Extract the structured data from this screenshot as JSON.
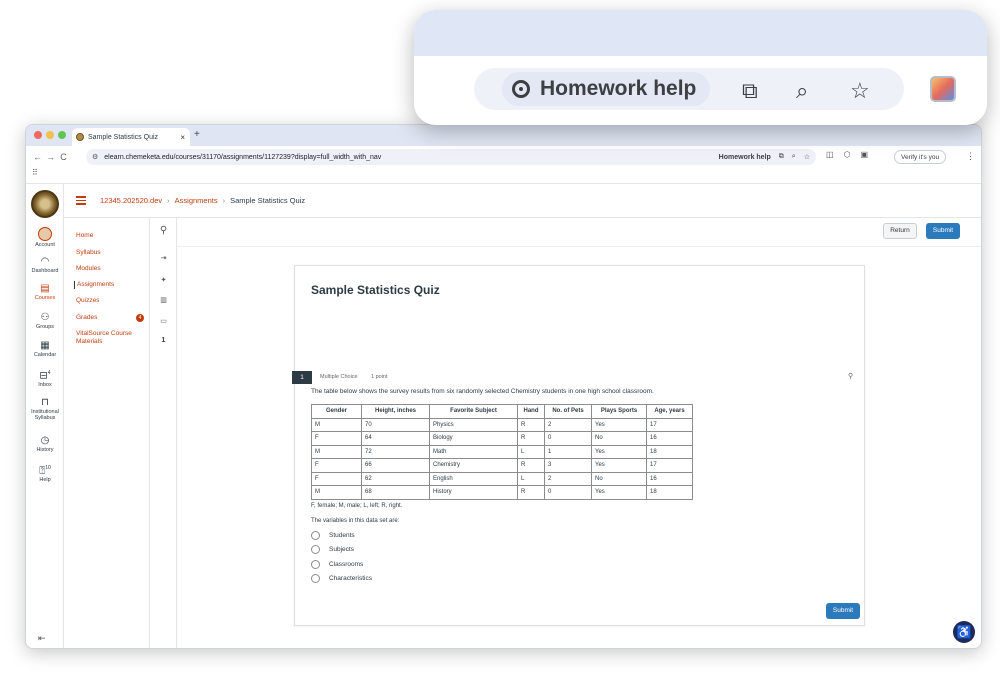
{
  "browser": {
    "tab_title": "Sample Statistics Quiz",
    "tab_close": "×",
    "new_tab": "+",
    "url": "elearn.chemeketa.edu/courses/31170/assignments/1127239?display=full_width_with_nav",
    "homework_help": "Homework help",
    "verify_label": "Verify it's you",
    "bookmarks_icon": "⠿"
  },
  "zoom": {
    "homework_help": "Homework help"
  },
  "breadcrumb": {
    "course": "12345.202520.dev",
    "section": "Assignments",
    "current": "Sample Statistics Quiz",
    "sep": "›"
  },
  "global_nav": {
    "account": "Account",
    "dashboard": "Dashboard",
    "courses": "Courses",
    "groups": "Groups",
    "calendar": "Calendar",
    "inbox": "Inbox",
    "inbox_count": "4",
    "institutional_syllabus": "Institutional Syllabus",
    "history": "History",
    "help": "Help",
    "help_count": "10"
  },
  "course_nav": {
    "home": "Home",
    "syllabus": "Syllabus",
    "modules": "Modules",
    "assignments": "Assignments",
    "quizzes": "Quizzes",
    "grades": "Grades",
    "grades_badge": "4",
    "vitalsource": "VitalSource Course Materials"
  },
  "question_nav": {
    "question_number": "1"
  },
  "actions": {
    "return": "Return",
    "submit": "Submit"
  },
  "quiz": {
    "title": "Sample Statistics Quiz",
    "question_number": "1",
    "question_type": "Multiple Choice",
    "points": "1 point",
    "prompt": "The table below shows the survey results from six randomly selected Chemistry students in one high school classroom.",
    "table": {
      "headers": [
        "Gender",
        "Height, inches",
        "Favorite Subject",
        "Hand",
        "No. of Pets",
        "Plays Sports",
        "Age, years"
      ],
      "rows": [
        [
          "M",
          "70",
          "Physics",
          "R",
          "2",
          "Yes",
          "17"
        ],
        [
          "F",
          "64",
          "Biology",
          "R",
          "0",
          "No",
          "16"
        ],
        [
          "M",
          "72",
          "Math",
          "L",
          "1",
          "Yes",
          "18"
        ],
        [
          "F",
          "66",
          "Chemistry",
          "R",
          "3",
          "Yes",
          "17"
        ],
        [
          "F",
          "62",
          "English",
          "L",
          "2",
          "No",
          "16"
        ],
        [
          "M",
          "68",
          "History",
          "R",
          "0",
          "Yes",
          "18"
        ]
      ]
    },
    "legend": "F, female; M, male; L, left; R, right.",
    "question": "The variables in this data set are:",
    "options": [
      "Students",
      "Subjects",
      "Classrooms",
      "Characteristics"
    ],
    "submit": "Submit"
  }
}
